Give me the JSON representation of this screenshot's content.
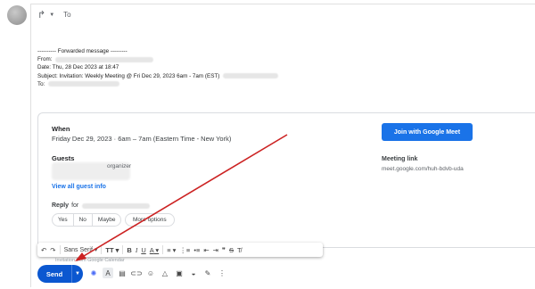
{
  "header": {
    "to_label": "To"
  },
  "forwarded": {
    "separator": "---------- Forwarded message ---------",
    "from_label": "From:",
    "date_line": "Date: Thu, 28 Dec 2023 at 18:47",
    "subject_line": "Subject: Invitation: Weekly Meeting @ Fri Dec 29, 2023 6am - 7am (EST)",
    "to_label": "To:"
  },
  "invite": {
    "when_label": "When",
    "when_value": "Friday Dec 29, 2023 · 6am – 7am (Eastern Time - New York)",
    "guests_label": "Guests",
    "organizer_text": "organizer",
    "view_all": "View all guest info",
    "reply_label": "Reply",
    "reply_for": "for",
    "reply_options": [
      "Yes",
      "No",
      "Maybe"
    ],
    "more_options": "More options",
    "meet_button": "Join with Google Meet",
    "meeting_link_label": "Meeting link",
    "meeting_link_url": "meet.google.com/huh-bdvb-uda"
  },
  "format_toolbar": {
    "font": "Sans Serif",
    "text_size": "T",
    "bold": "B",
    "italic": "I",
    "underline": "U",
    "text_color": "A",
    "strike": "S"
  },
  "below_text": "Invitation from Google Calendar",
  "compose": {
    "send_label": "Send"
  },
  "annotation_color": "#cc2222"
}
